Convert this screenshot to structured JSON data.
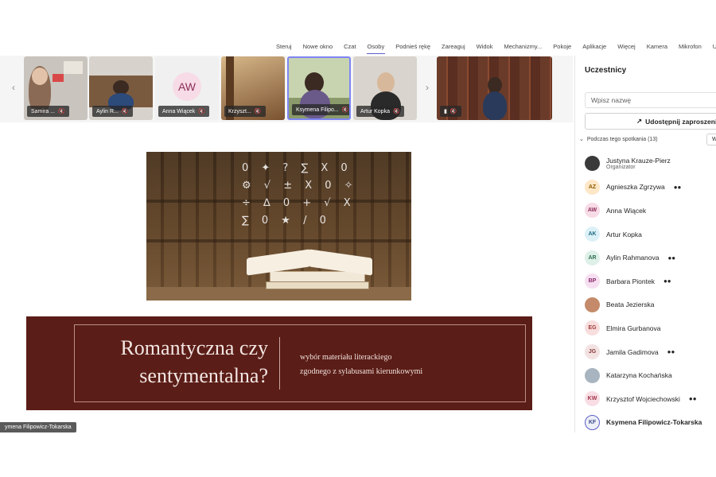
{
  "toolbar": {
    "items": [
      "Steruj",
      "Nowe okno",
      "Czat",
      "Osoby",
      "Podnieś rękę",
      "Zareaguj",
      "Widok",
      "Mechanizmy...",
      "Pokoje",
      "Aplikacje",
      "Więcej",
      "Kamera",
      "Mikrofon",
      "Udostę"
    ],
    "active": "Osoby"
  },
  "video_strip": {
    "tiles": [
      {
        "name": "Samira ...",
        "bg": "#c9c4bd"
      },
      {
        "name": "Aylin R...",
        "bg": "#d7d2cc"
      },
      {
        "name": "Anna Wiącek",
        "initials": "AW",
        "bg": "#f0f0f0"
      },
      {
        "name": "Krzyszt...",
        "bg": "#a77a4e"
      },
      {
        "name": "Ksymena Filipo...",
        "bg": "#8a9a6a"
      },
      {
        "name": "Artur Kopka",
        "bg": "#d9d4cd"
      },
      {
        "name": "",
        "bg": "#6b3b2a"
      }
    ],
    "selected": "Ksymena Filipo..."
  },
  "slide": {
    "title_line1": "Romantyczna czy",
    "title_line2": "sentymentalna?",
    "subtitle_line1": "wybór materiału literackiego",
    "subtitle_line2": "zgodnego z sylabusami kierunkowymi"
  },
  "presenter_label": "ymena Filipowicz-Tokarska",
  "panel": {
    "title": "Uczestnicy",
    "search_placeholder": "Wpisz nazwę",
    "share_label": "Udostępnij zaproszeni",
    "section_label": "Podczas tego spotkania (13)",
    "section_button": "W",
    "participants": [
      {
        "initials": "",
        "name": "Justyna Krauze-Pierz",
        "role": "Organizator",
        "avatar_bg": "#3a3a3a",
        "avatar_fg": "#ffffff",
        "badge": ""
      },
      {
        "initials": "AZ",
        "name": "Agnieszka Zgrzywa",
        "role": "",
        "avatar_bg": "#fde7c7",
        "avatar_fg": "#8a5a00",
        "badge": "ob"
      },
      {
        "initials": "AW",
        "name": "Anna Wiącek",
        "role": "",
        "avatar_bg": "#f7dbe6",
        "avatar_fg": "#8c2e58",
        "badge": ""
      },
      {
        "initials": "AK",
        "name": "Artur Kopka",
        "role": "",
        "avatar_bg": "#dcf1f7",
        "avatar_fg": "#1f6b84",
        "badge": ""
      },
      {
        "initials": "AR",
        "name": "Aylin Rahmanova",
        "role": "",
        "avatar_bg": "#def0e8",
        "avatar_fg": "#2f6f52",
        "badge": "ob"
      },
      {
        "initials": "BP",
        "name": "Barbara Piontek",
        "role": "",
        "avatar_bg": "#f6dff0",
        "avatar_fg": "#8a2a6f",
        "badge": "ob"
      },
      {
        "initials": "",
        "name": "Beata Jezierska",
        "role": "",
        "avatar_bg": "#c48a6a",
        "avatar_fg": "#ffffff",
        "badge": ""
      },
      {
        "initials": "EG",
        "name": "Elmira Gurbanova",
        "role": "",
        "avatar_bg": "#f8dede",
        "avatar_fg": "#a33a3a",
        "badge": ""
      },
      {
        "initials": "JG",
        "name": "Jamila Gadimova",
        "role": "",
        "avatar_bg": "#f3e2e2",
        "avatar_fg": "#8a3a3a",
        "badge": "ob"
      },
      {
        "initials": "",
        "name": "Katarzyna Kochańska",
        "role": "",
        "avatar_bg": "#a8b4bf",
        "avatar_fg": "#ffffff",
        "badge": ""
      },
      {
        "initials": "KW",
        "name": "Krzysztof Wojciechowski",
        "role": "",
        "avatar_bg": "#f8dee4",
        "avatar_fg": "#a3334a",
        "badge": "ob"
      },
      {
        "initials": "KF",
        "name": "Ksymena Filipowicz-Tokarska",
        "role": "",
        "avatar_bg": "#eef0f8",
        "avatar_fg": "#3a4a8a",
        "badge": ""
      }
    ]
  }
}
